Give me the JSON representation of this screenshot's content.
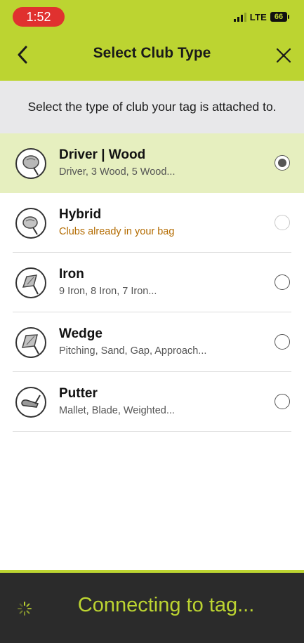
{
  "status_bar": {
    "time": "1:52",
    "network": "LTE",
    "battery": "66"
  },
  "header": {
    "title": "Select Club Type",
    "back_icon": "chevron-left-icon",
    "close_icon": "close-icon"
  },
  "instruction": "Select the type of club your tag is attached to.",
  "clubs": [
    {
      "name": "Driver | Wood",
      "subtitle": "Driver, 3 Wood, 5 Wood...",
      "icon": "driver-club-icon",
      "selected": true,
      "disabled": false
    },
    {
      "name": "Hybrid",
      "subtitle": "Clubs already in your bag",
      "icon": "hybrid-club-icon",
      "selected": false,
      "disabled": true
    },
    {
      "name": "Iron",
      "subtitle": "9 Iron, 8 Iron, 7 Iron...",
      "icon": "iron-club-icon",
      "selected": false,
      "disabled": false
    },
    {
      "name": "Wedge",
      "subtitle": "Pitching, Sand, Gap, Approach...",
      "icon": "wedge-club-icon",
      "selected": false,
      "disabled": false
    },
    {
      "name": "Putter",
      "subtitle": "Mallet, Blade, Weighted...",
      "icon": "putter-club-icon",
      "selected": false,
      "disabled": false
    }
  ],
  "footer": {
    "status": "Connecting to tag...",
    "spinner_icon": "loading-spinner-icon"
  },
  "colors": {
    "accent": "#bcd431",
    "selected_row": "#e6efbf",
    "warning_text": "#b36b00",
    "status_time_bg": "#e0312f",
    "footer_bg": "#2b2b2b"
  }
}
